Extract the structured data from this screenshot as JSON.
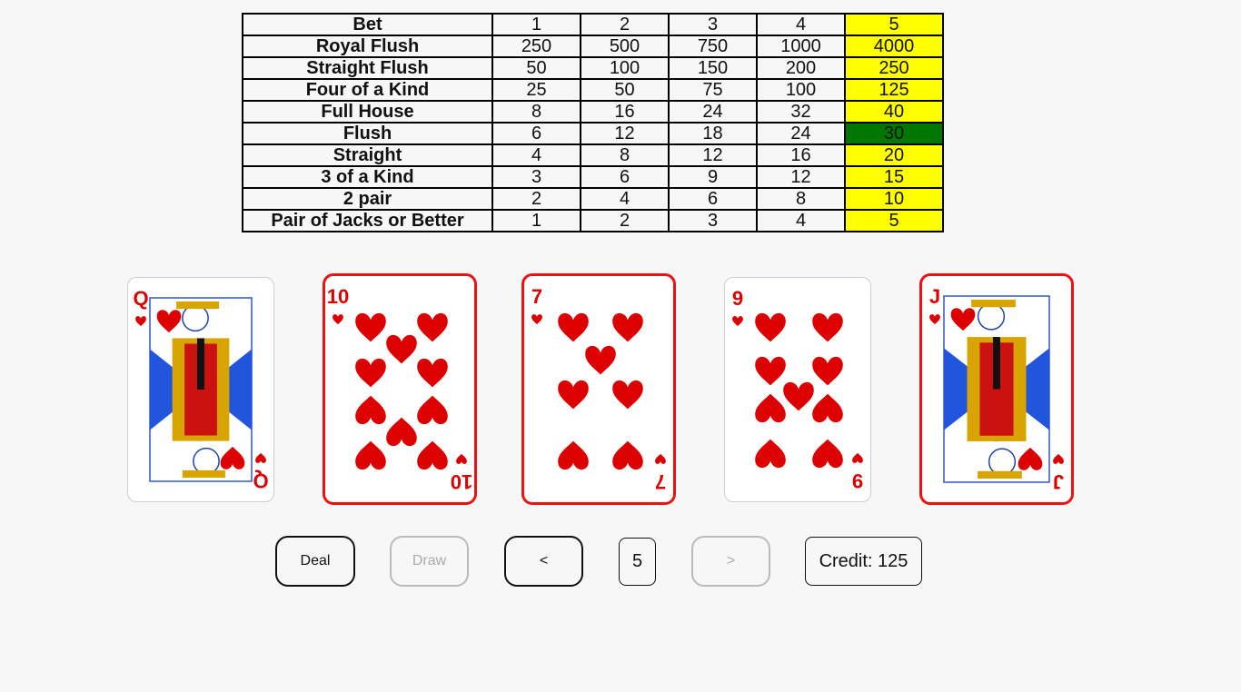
{
  "paytable": {
    "header": {
      "label": "Bet",
      "bets": [
        "1",
        "2",
        "3",
        "4",
        "5"
      ]
    },
    "rows": [
      {
        "hand": "Royal Flush",
        "payouts": [
          "250",
          "500",
          "750",
          "1000",
          "4000"
        ]
      },
      {
        "hand": "Straight Flush",
        "payouts": [
          "50",
          "100",
          "150",
          "200",
          "250"
        ]
      },
      {
        "hand": "Four of a Kind",
        "payouts": [
          "25",
          "50",
          "75",
          "100",
          "125"
        ]
      },
      {
        "hand": "Full House",
        "payouts": [
          "8",
          "16",
          "24",
          "32",
          "40"
        ]
      },
      {
        "hand": "Flush",
        "payouts": [
          "6",
          "12",
          "18",
          "24",
          "30"
        ]
      },
      {
        "hand": "Straight",
        "payouts": [
          "4",
          "8",
          "12",
          "16",
          "20"
        ]
      },
      {
        "hand": "3 of a Kind",
        "payouts": [
          "3",
          "6",
          "9",
          "12",
          "15"
        ]
      },
      {
        "hand": "2 pair",
        "payouts": [
          "2",
          "4",
          "6",
          "8",
          "10"
        ]
      },
      {
        "hand": "Pair of Jacks or Better",
        "payouts": [
          "1",
          "2",
          "3",
          "4",
          "5"
        ]
      }
    ],
    "selected_bet_column": 5,
    "winning_hand": "Flush",
    "highlight_color": "#ffff00",
    "win_color": "#007700"
  },
  "hand": [
    {
      "rank": "Q",
      "suit": "hearts",
      "held": false,
      "face": "queen"
    },
    {
      "rank": "10",
      "suit": "hearts",
      "held": true,
      "face": null
    },
    {
      "rank": "7",
      "suit": "hearts",
      "held": true,
      "face": null
    },
    {
      "rank": "9",
      "suit": "hearts",
      "held": false,
      "face": null
    },
    {
      "rank": "J",
      "suit": "hearts",
      "held": true,
      "face": "jack"
    }
  ],
  "suit_color": "#dd0000",
  "held_border_color": "#ee1111",
  "controls": {
    "deal_label": "Deal",
    "draw_label": "Draw",
    "prev_bet_label": "<",
    "bet_value": "5",
    "next_bet_label": ">",
    "credit_text": "Credit: 125"
  }
}
